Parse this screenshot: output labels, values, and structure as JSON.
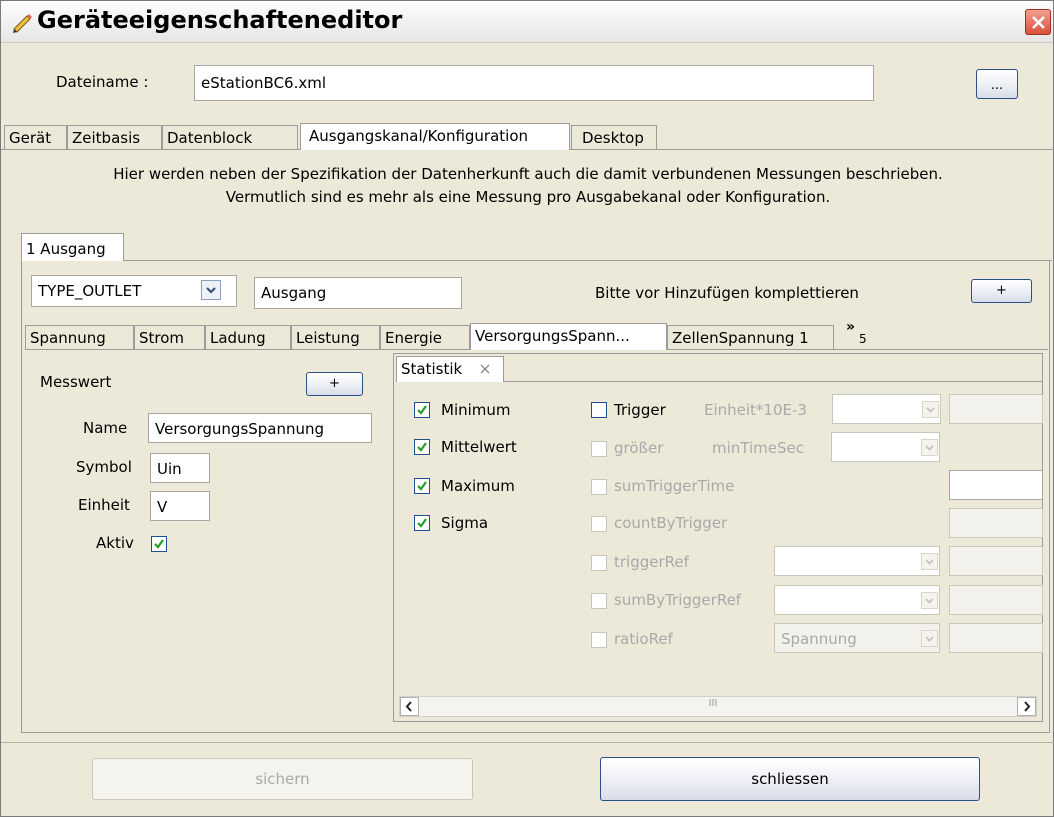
{
  "window": {
    "title": "Geräteeigenschafteneditor"
  },
  "file": {
    "label": "Dateiname :",
    "value": "eStationBC6.xml",
    "browse_label": "..."
  },
  "main_tabs": [
    "Gerät",
    "Zeitbasis",
    "Datenblock",
    "Ausgangskanal/Konfiguration",
    "Desktop"
  ],
  "description": {
    "line1": "Hier werden neben der Spezifikation der Datenherkunft auch die damit verbundenen Messungen beschrieben.",
    "line2": "Vermutlich sind es mehr als eine Messung pro Ausgabekanal oder Konfiguration."
  },
  "channel_tab": "1 Ausgang",
  "channel": {
    "type_value": "TYPE_OUTLET",
    "name_value": "Ausgang",
    "hint": "Bitte vor Hinzufügen komplettieren",
    "add_label": "+"
  },
  "measure_tabs": [
    "Spannung",
    "Strom",
    "Ladung",
    "Leistung",
    "Energie",
    "VersorgungsSpann...",
    "ZellenSpannung 1"
  ],
  "measure_overflow": "»",
  "measure_overflow_count": "5",
  "measure": {
    "title": "Messwert",
    "add_label": "+",
    "name_label": "Name",
    "name_value": "VersorgungsSpannung",
    "symbol_label": "Symbol",
    "symbol_value": "Uin",
    "unit_label": "Einheit",
    "unit_value": "V",
    "active_label": "Aktiv",
    "active_checked": true
  },
  "statistics": {
    "tab_label": "Statistik",
    "minimum": "Minimum",
    "mean": "Mittelwert",
    "maximum": "Maximum",
    "sigma": "Sigma",
    "trigger": "Trigger",
    "unit_factor": "Einheit*10E-3",
    "greater": "größer",
    "min_time": "minTimeSec",
    "sum_trigger_time": "sumTriggerTime",
    "count_by_trigger": "countByTrigger",
    "trigger_ref": "triggerRef",
    "sum_by_trigger_ref": "sumByTriggerRef",
    "ratio_ref": "ratioRef",
    "ratio_ref_value": "Spannung",
    "scroll_thumb": "III"
  },
  "footer": {
    "save_label": "sichern",
    "close_label": "schliessen"
  },
  "colors": {
    "dialog_bg": "#ece9d8",
    "border_blue": "#2d4f8a",
    "check_green": "#21a121",
    "close_red": "#d9503a"
  }
}
